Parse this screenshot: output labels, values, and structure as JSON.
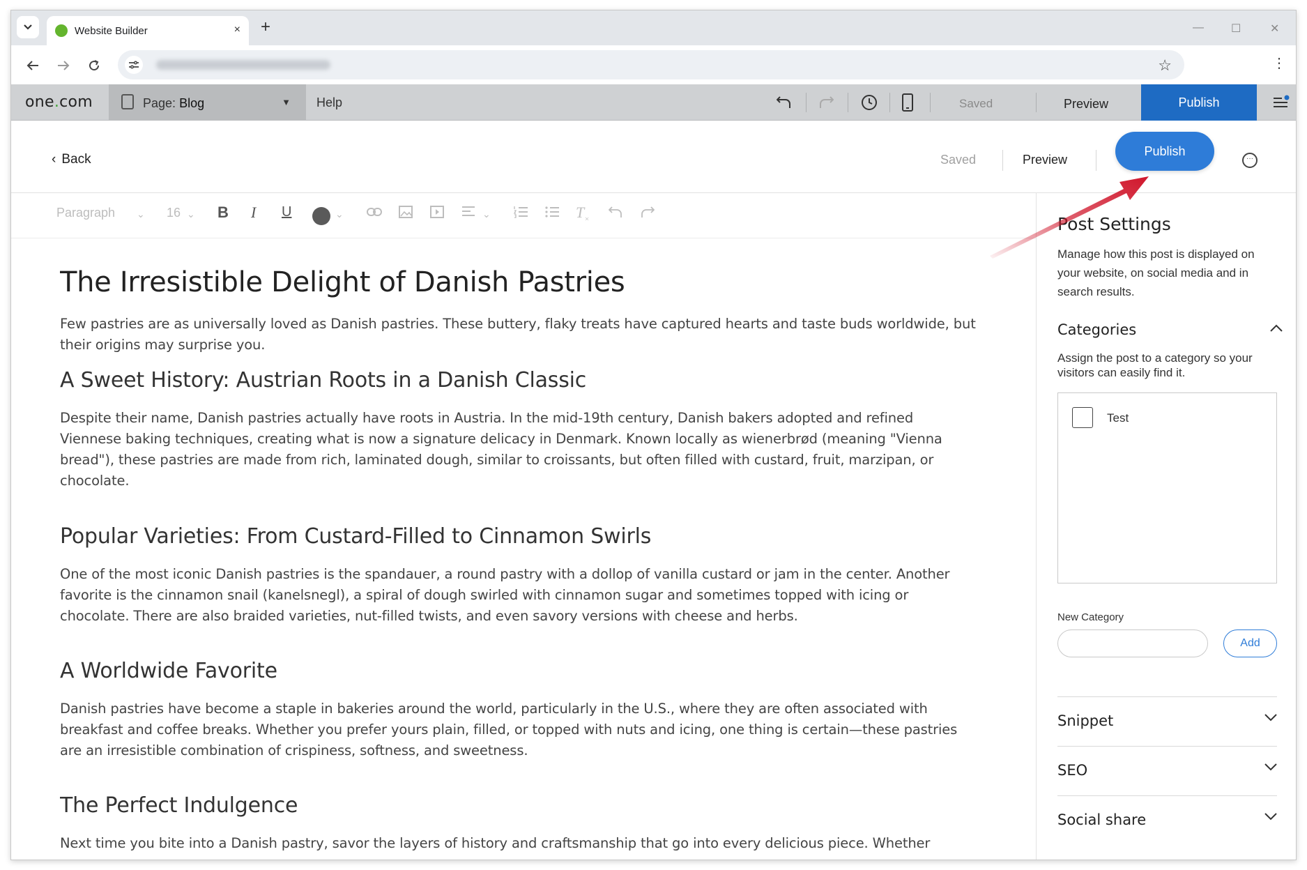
{
  "browser": {
    "tab_title": "Website Builder",
    "tab_close": "×",
    "new_tab": "+",
    "minimize": "—",
    "maximize": "☐",
    "close": "✕"
  },
  "builder": {
    "logo_pre": "one",
    "logo_dot": ".",
    "logo_post": "com",
    "page_prefix": "Page:",
    "page_name": "Blog",
    "help": "Help",
    "saved": "Saved",
    "preview": "Preview",
    "publish": "Publish"
  },
  "editor_header": {
    "back": "Back",
    "saved": "Saved",
    "preview": "Preview",
    "publish": "Publish",
    "more_icon": "ellipsis-circle-icon"
  },
  "format_toolbar": {
    "block_style": "Paragraph",
    "font_size": "16",
    "bold": "B",
    "italic": "I",
    "underline": "U",
    "clear_format": "T",
    "text_color": "#5a5a5a"
  },
  "article": {
    "title": "The Irresistible Delight of Danish Pastries",
    "intro_1": "Few pastries are as universally loved as Danish pastries. These buttery, flaky treats have captured hearts and taste buds worldwide, but",
    "intro_2": "their origins may surprise you.",
    "sections": [
      {
        "heading": "A Sweet History: Austrian Roots in a Danish Classic",
        "lines": [
          "Despite their name, Danish pastries actually have roots in Austria. In the mid-19th century, Danish bakers adopted and refined",
          "Viennese baking techniques, creating what is now a signature delicacy in Denmark. Known locally as wienerbrød (meaning \"Vienna",
          "bread\"), these pastries are made from rich, laminated dough, similar to croissants, but often filled with custard, fruit, marzipan, or",
          "chocolate."
        ]
      },
      {
        "heading": "Popular Varieties: From Custard-Filled to Cinnamon Swirls",
        "lines": [
          "One of the most iconic Danish pastries is the spandauer, a round pastry with a dollop of vanilla custard or jam in the center. Another",
          "favorite is the cinnamon snail (kanelsnegl), a spiral of dough swirled with cinnamon sugar and sometimes topped with icing or",
          "chocolate. There are also braided varieties, nut-filled twists, and even savory versions with cheese and herbs."
        ]
      },
      {
        "heading": "A Worldwide Favorite",
        "lines": [
          "Danish pastries have become a staple in bakeries around the world, particularly in the U.S., where they are often associated with",
          "breakfast and coffee breaks. Whether you prefer yours plain, filled, or topped with nuts and icing, one thing is certain—these pastries",
          "are an irresistible combination of crispiness, softness, and sweetness."
        ]
      },
      {
        "heading": "The Perfect Indulgence",
        "lines": [
          "Next time you bite into a Danish pastry, savor the layers of history and craftsmanship that go into every delicious piece. Whether"
        ]
      }
    ]
  },
  "panel": {
    "title": "Post Settings",
    "description": "Manage how this post is displayed on your website, on social media and in search results.",
    "categories_title": "Categories",
    "categories_desc": "Assign the post to a category so your visitors can easily find it.",
    "categories": [
      {
        "label": "Test",
        "checked": false
      }
    ],
    "new_category_label": "New Category",
    "new_category_value": "",
    "add_label": "Add",
    "accordions": [
      "Snippet",
      "SEO",
      "Social share"
    ]
  },
  "colors": {
    "publish_blue": "#2e7cd8",
    "toolbar_publish": "#1e6bc3",
    "arrow_red": "#d0162b",
    "logo_green": "#3fa535"
  }
}
